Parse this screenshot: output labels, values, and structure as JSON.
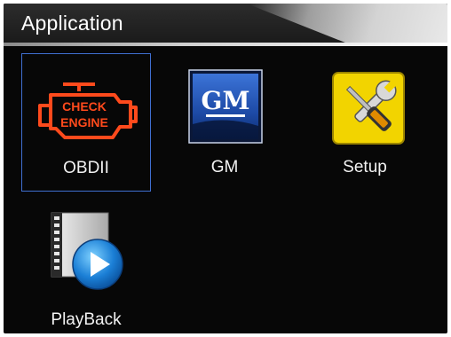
{
  "window": {
    "title": "Application"
  },
  "menu": {
    "selected_index": 0,
    "items": [
      {
        "label": "OBDII",
        "icon": "check-engine-icon",
        "icon_text_1": "CHECK",
        "icon_text_2": "ENGINE"
      },
      {
        "label": "GM",
        "icon": "gm-logo-icon",
        "icon_text": "GM"
      },
      {
        "label": "Setup",
        "icon": "tools-icon"
      },
      {
        "label": "PlayBack",
        "icon": "playback-film-icon"
      }
    ]
  },
  "colors": {
    "selection_border": "#3f6fd0",
    "check_engine": "#ff4a1c",
    "gm_blue": "#1f4fb0",
    "setup_yellow": "#f2d400"
  }
}
